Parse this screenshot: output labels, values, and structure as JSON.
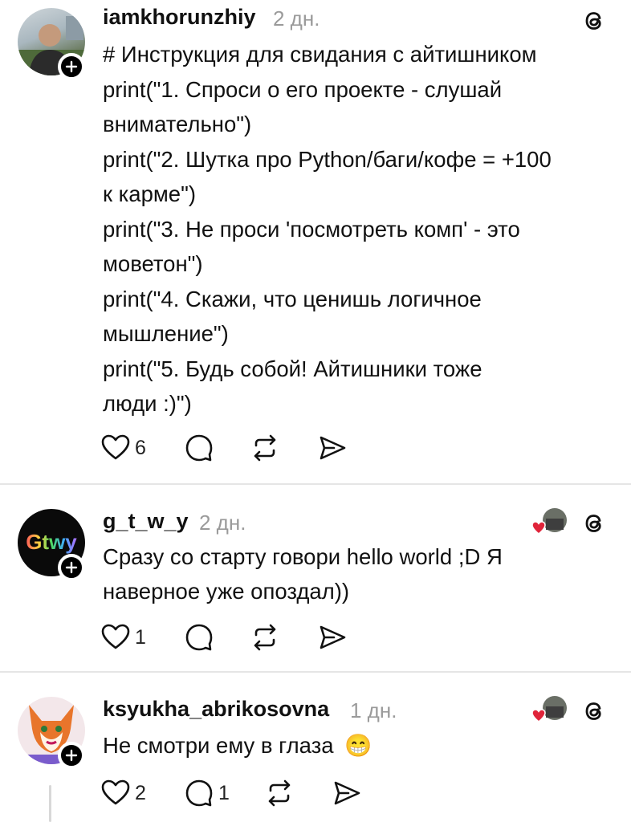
{
  "posts": [
    {
      "username": "iamkhorunzhiy",
      "time": "2 дн.",
      "lines": [
        "# Инструкция для свидания с айтишником",
        "print(\"1. Спроси о его проекте - слушай",
        "внимательно\")",
        "print(\"2. Шутка про Python/баги/кофе = +100",
        "к карме\")",
        "print(\"3. Не проси 'посмотреть комп' - это",
        "моветон\")",
        "print(\"4. Скажи, что ценишь логичное",
        "мышление\")",
        "print(\"5. Будь собой! Айтишники тоже",
        "люди :)\")"
      ],
      "likes": "6",
      "replies": "",
      "avatar_icon": "man-photo-avatar"
    },
    {
      "username": "g_t_w_y",
      "time": "2 дн.",
      "lines": [
        "Сразу со старту говори hello world ;D Я",
        "наверное уже опоздал))"
      ],
      "likes": "1",
      "replies": "",
      "avatar_icon": "gtwy-logo-avatar"
    },
    {
      "username": "ksyukha_abrikosovna",
      "time": "1 дн.",
      "lines": [
        "Не смотри ему в глаза"
      ],
      "emoji": "😁",
      "likes": "2",
      "replies": "1",
      "avatar_icon": "fox-drawing-avatar"
    }
  ],
  "colors": {
    "text": "#111111",
    "muted": "#9a9a9a",
    "heart_red": "#e0243a",
    "divider": "#e5e5e5"
  }
}
